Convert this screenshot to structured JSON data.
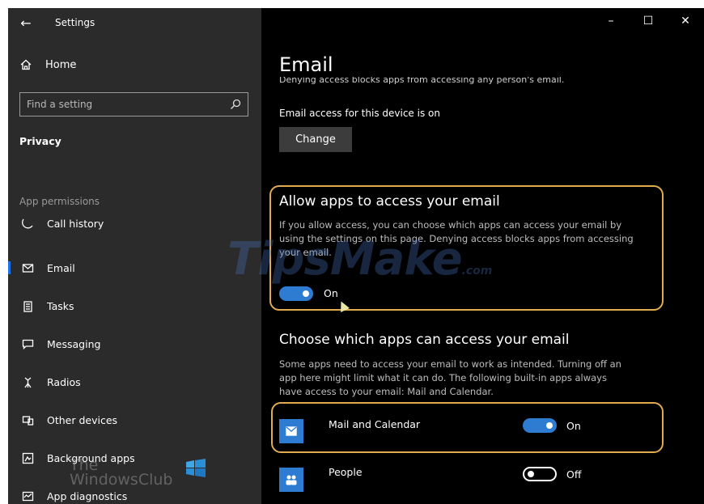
{
  "window": {
    "title": "Settings",
    "controls": {
      "minimize": "–",
      "maximize": "☐",
      "close": "✕"
    }
  },
  "sidebar": {
    "home_label": "Home",
    "search_placeholder": "Find a setting",
    "section_title": "Privacy",
    "group_label": "App permissions",
    "items": [
      {
        "label": "Call history",
        "icon": "call-history-icon"
      },
      {
        "label": "Email",
        "icon": "mail-icon",
        "active": true
      },
      {
        "label": "Tasks",
        "icon": "tasks-icon"
      },
      {
        "label": "Messaging",
        "icon": "messaging-icon"
      },
      {
        "label": "Radios",
        "icon": "radio-tower-icon"
      },
      {
        "label": "Other devices",
        "icon": "devices-icon"
      },
      {
        "label": "Background apps",
        "icon": "background-apps-icon"
      },
      {
        "label": "App diagnostics",
        "icon": "diagnostics-icon"
      }
    ]
  },
  "main": {
    "page_title": "Email",
    "clipped_text": "Denying access blocks apps from accessing any person's email.",
    "access_status": "Email access for this device is on",
    "change_button": "Change",
    "allow_section": {
      "heading": "Allow apps to access your email",
      "description": "If you allow access, you can choose which apps can access your email by using the settings on this page. Denying access blocks apps from accessing your email.",
      "toggle_label": "On",
      "toggle_on": true
    },
    "choose_section": {
      "heading": "Choose which apps can access your email",
      "description": "Some apps need to access your email to work as intended. Turning off an app here might limit what it can do. The following built-in apps always have access to your email: Mail and Calendar."
    },
    "apps": [
      {
        "name": "Mail and Calendar",
        "toggle_label": "On",
        "toggle_on": true,
        "icon": "mail-calendar-icon"
      },
      {
        "name": "People",
        "toggle_label": "Off",
        "toggle_on": false,
        "icon": "people-icon"
      }
    ]
  },
  "watermarks": {
    "tipsmake": "TipsMake",
    "tipsmake_suffix": ".com",
    "windowsclub_line1": "The",
    "windowsclub_line2": "WindowsClub"
  },
  "colors": {
    "accent": "#2e7cd1",
    "highlight_border": "#e1ac4f",
    "sidebar_bg": "#2b2b2b",
    "main_bg": "#000000"
  }
}
